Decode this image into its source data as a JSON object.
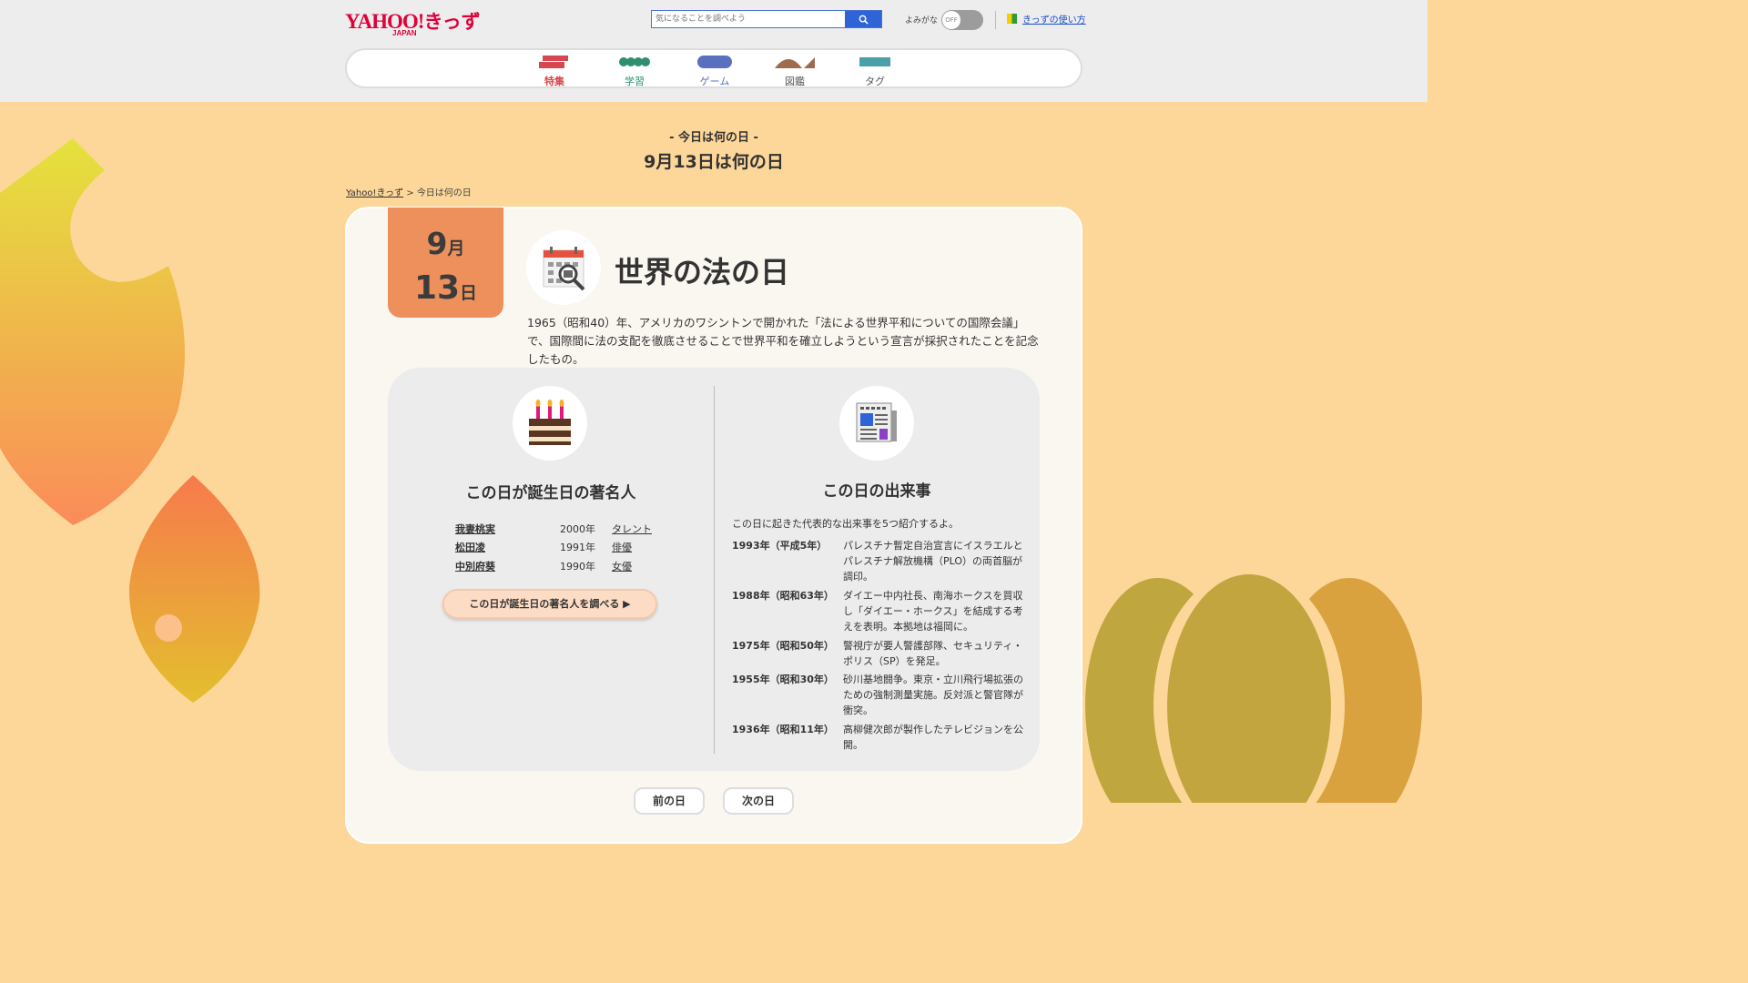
{
  "header": {
    "logo_main": "YAHOO!",
    "logo_kids": "きっず",
    "logo_japan": "JAPAN",
    "search_placeholder": "気になることを調べよう",
    "yomigana_label": "よみがな",
    "toggle_state": "OFF",
    "howto_link": "きっずの使い方"
  },
  "nav": {
    "items": [
      {
        "label": "特集",
        "color": "#d7474f"
      },
      {
        "label": "学習",
        "color": "#2f8f6c"
      },
      {
        "label": "ゲーム",
        "color": "#5b6fbf"
      },
      {
        "label": "図鑑",
        "color": "#a06a4e"
      },
      {
        "label": "タグ",
        "color": "#4aa0a8"
      }
    ]
  },
  "page": {
    "subtitle": "- 今日は何の日 -",
    "title": "9月13日は何の日"
  },
  "breadcrumb": {
    "home": "Yahoo!きっず",
    "separator": ">",
    "current": "今日は何の日"
  },
  "date": {
    "month": "9",
    "month_unit": "月",
    "day": "13",
    "day_unit": "日"
  },
  "feature": {
    "title": "世界の法の日",
    "description": "1965（昭和40）年、アメリカのワシントンで開かれた「法による世界平和についての国際会議」で、国際間に法の支配を徹底させることで世界平和を確立しようという宣言が採択されたことを記念したもの。"
  },
  "birthdays": {
    "title": "この日が誕生日の著名人",
    "people": [
      {
        "name": "我妻桃実",
        "year": "2000年",
        "job": "タレント"
      },
      {
        "name": "松田凌",
        "year": "1991年",
        "job": "俳優"
      },
      {
        "name": "中別府葵",
        "year": "1990年",
        "job": "女優"
      }
    ],
    "button": "この日が誕生日の著名人を調べる ▶"
  },
  "events": {
    "title": "この日の出来事",
    "intro": "この日に起きた代表的な出来事を5つ紹介するよ。",
    "items": [
      {
        "year": "1993年（平成5年）",
        "text": "パレスチナ暫定自治宣言にイスラエルとパレスチナ解放機構（PLO）の両首脳が調印。"
      },
      {
        "year": "1988年（昭和63年）",
        "text": "ダイエー中内社長、南海ホークスを買収し「ダイエー・ホークス」を結成する考えを表明。本拠地は福岡に。"
      },
      {
        "year": "1975年（昭和50年）",
        "text": "警視庁が要人警護部隊、セキュリティ・ポリス（SP）を発足。"
      },
      {
        "year": "1955年（昭和30年）",
        "text": "砂川基地闘争。東京・立川飛行場拡張のための強制測量実施。反対派と警官隊が衝突。"
      },
      {
        "year": "1936年（昭和11年）",
        "text": "高柳健次郎が製作したテレビジョンを公開。"
      }
    ]
  },
  "pager": {
    "prev": "前の日",
    "next": "次の日"
  },
  "colors": {
    "accent_date": "#ee905c",
    "link_blue": "#1a4ecf",
    "brand_red": "#e0003a",
    "page_bg": "#fdd79a"
  }
}
